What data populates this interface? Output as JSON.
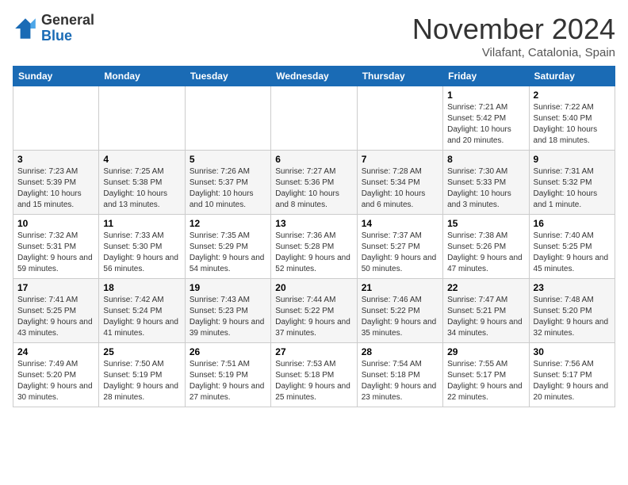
{
  "header": {
    "logo_general": "General",
    "logo_blue": "Blue",
    "month_title": "November 2024",
    "location": "Vilafant, Catalonia, Spain"
  },
  "days_of_week": [
    "Sunday",
    "Monday",
    "Tuesday",
    "Wednesday",
    "Thursday",
    "Friday",
    "Saturday"
  ],
  "weeks": [
    [
      {
        "day": "",
        "info": ""
      },
      {
        "day": "",
        "info": ""
      },
      {
        "day": "",
        "info": ""
      },
      {
        "day": "",
        "info": ""
      },
      {
        "day": "",
        "info": ""
      },
      {
        "day": "1",
        "info": "Sunrise: 7:21 AM\nSunset: 5:42 PM\nDaylight: 10 hours and 20 minutes."
      },
      {
        "day": "2",
        "info": "Sunrise: 7:22 AM\nSunset: 5:40 PM\nDaylight: 10 hours and 18 minutes."
      }
    ],
    [
      {
        "day": "3",
        "info": "Sunrise: 7:23 AM\nSunset: 5:39 PM\nDaylight: 10 hours and 15 minutes."
      },
      {
        "day": "4",
        "info": "Sunrise: 7:25 AM\nSunset: 5:38 PM\nDaylight: 10 hours and 13 minutes."
      },
      {
        "day": "5",
        "info": "Sunrise: 7:26 AM\nSunset: 5:37 PM\nDaylight: 10 hours and 10 minutes."
      },
      {
        "day": "6",
        "info": "Sunrise: 7:27 AM\nSunset: 5:36 PM\nDaylight: 10 hours and 8 minutes."
      },
      {
        "day": "7",
        "info": "Sunrise: 7:28 AM\nSunset: 5:34 PM\nDaylight: 10 hours and 6 minutes."
      },
      {
        "day": "8",
        "info": "Sunrise: 7:30 AM\nSunset: 5:33 PM\nDaylight: 10 hours and 3 minutes."
      },
      {
        "day": "9",
        "info": "Sunrise: 7:31 AM\nSunset: 5:32 PM\nDaylight: 10 hours and 1 minute."
      }
    ],
    [
      {
        "day": "10",
        "info": "Sunrise: 7:32 AM\nSunset: 5:31 PM\nDaylight: 9 hours and 59 minutes."
      },
      {
        "day": "11",
        "info": "Sunrise: 7:33 AM\nSunset: 5:30 PM\nDaylight: 9 hours and 56 minutes."
      },
      {
        "day": "12",
        "info": "Sunrise: 7:35 AM\nSunset: 5:29 PM\nDaylight: 9 hours and 54 minutes."
      },
      {
        "day": "13",
        "info": "Sunrise: 7:36 AM\nSunset: 5:28 PM\nDaylight: 9 hours and 52 minutes."
      },
      {
        "day": "14",
        "info": "Sunrise: 7:37 AM\nSunset: 5:27 PM\nDaylight: 9 hours and 50 minutes."
      },
      {
        "day": "15",
        "info": "Sunrise: 7:38 AM\nSunset: 5:26 PM\nDaylight: 9 hours and 47 minutes."
      },
      {
        "day": "16",
        "info": "Sunrise: 7:40 AM\nSunset: 5:25 PM\nDaylight: 9 hours and 45 minutes."
      }
    ],
    [
      {
        "day": "17",
        "info": "Sunrise: 7:41 AM\nSunset: 5:25 PM\nDaylight: 9 hours and 43 minutes."
      },
      {
        "day": "18",
        "info": "Sunrise: 7:42 AM\nSunset: 5:24 PM\nDaylight: 9 hours and 41 minutes."
      },
      {
        "day": "19",
        "info": "Sunrise: 7:43 AM\nSunset: 5:23 PM\nDaylight: 9 hours and 39 minutes."
      },
      {
        "day": "20",
        "info": "Sunrise: 7:44 AM\nSunset: 5:22 PM\nDaylight: 9 hours and 37 minutes."
      },
      {
        "day": "21",
        "info": "Sunrise: 7:46 AM\nSunset: 5:22 PM\nDaylight: 9 hours and 35 minutes."
      },
      {
        "day": "22",
        "info": "Sunrise: 7:47 AM\nSunset: 5:21 PM\nDaylight: 9 hours and 34 minutes."
      },
      {
        "day": "23",
        "info": "Sunrise: 7:48 AM\nSunset: 5:20 PM\nDaylight: 9 hours and 32 minutes."
      }
    ],
    [
      {
        "day": "24",
        "info": "Sunrise: 7:49 AM\nSunset: 5:20 PM\nDaylight: 9 hours and 30 minutes."
      },
      {
        "day": "25",
        "info": "Sunrise: 7:50 AM\nSunset: 5:19 PM\nDaylight: 9 hours and 28 minutes."
      },
      {
        "day": "26",
        "info": "Sunrise: 7:51 AM\nSunset: 5:19 PM\nDaylight: 9 hours and 27 minutes."
      },
      {
        "day": "27",
        "info": "Sunrise: 7:53 AM\nSunset: 5:18 PM\nDaylight: 9 hours and 25 minutes."
      },
      {
        "day": "28",
        "info": "Sunrise: 7:54 AM\nSunset: 5:18 PM\nDaylight: 9 hours and 23 minutes."
      },
      {
        "day": "29",
        "info": "Sunrise: 7:55 AM\nSunset: 5:17 PM\nDaylight: 9 hours and 22 minutes."
      },
      {
        "day": "30",
        "info": "Sunrise: 7:56 AM\nSunset: 5:17 PM\nDaylight: 9 hours and 20 minutes."
      }
    ]
  ]
}
